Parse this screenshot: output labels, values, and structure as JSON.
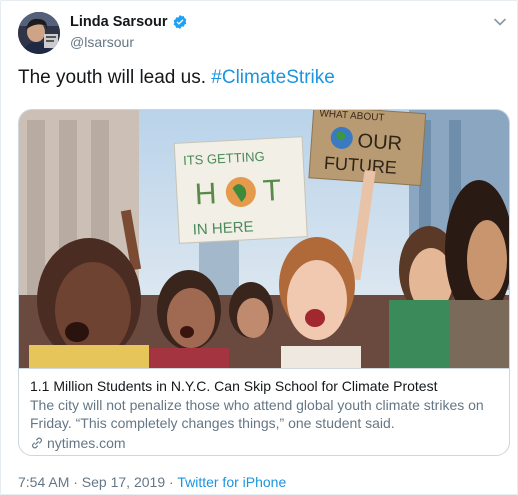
{
  "tweet": {
    "author_name": "Linda Sarsour",
    "author_handle": "@lsarsour",
    "text_plain": "The youth will lead us.",
    "text_hashtag": "#ClimateStrike",
    "timestamp": "7:54 AM · Sep 17, 2019",
    "separator": "·",
    "source": "Twitter for iPhone"
  },
  "card": {
    "title": "1.1 Million Students in N.Y.C. Can Skip School for Climate Protest",
    "description": "The city will not penalize those who attend global youth climate strikes on Friday. “This completely changes things,” one student said.",
    "domain": "nytimes.com",
    "image": {
      "sign_left_text": [
        "ITS GETTING",
        "H",
        "T",
        "IN HERE"
      ],
      "sign_right_text": [
        "WHAT ABOUT",
        "OUR",
        "FUTURE"
      ]
    }
  },
  "colors": {
    "link_blue": "#1b95e0",
    "text_gray": "#657786",
    "verified_blue": "#1da1f2",
    "border": "#ccd6dd"
  },
  "icons": {
    "verified": "verified-badge-icon",
    "caret": "chevron-down-icon",
    "link": "link-icon"
  }
}
